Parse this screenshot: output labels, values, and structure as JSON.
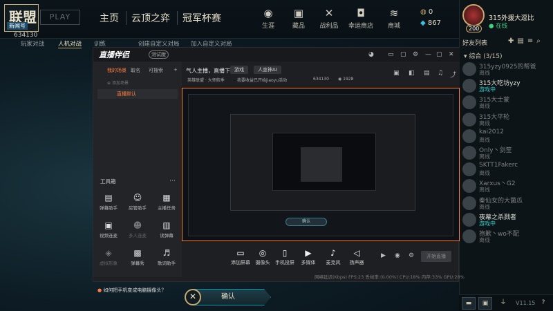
{
  "game": {
    "logo_text": "联盟",
    "logo_tag": "新闻号",
    "play_label": "PLAY",
    "user_id": "634130",
    "nav": [
      "主页",
      "云顶之弈",
      "冠军杯赛"
    ],
    "top_icons": [
      "生涯",
      "藏品",
      "战利品",
      "幸运商店",
      "商城"
    ],
    "currency_blue": "0",
    "currency_orange": "867",
    "subnav": [
      "玩家对战",
      "人机对战",
      "训练",
      "创建自定义对局",
      "加入自定义对局"
    ],
    "active_subnav": "人机对战",
    "confirm_label": "确认",
    "version": "V11.15"
  },
  "profile": {
    "name": "315外援大逗比",
    "status": "在线",
    "level": "200"
  },
  "friends": {
    "title": "好友列表",
    "group": "综合 (3/15)",
    "list": [
      {
        "name": "315yzy0925的帮爸",
        "status": "离线",
        "online": false
      },
      {
        "name": "315大吃坊yzy",
        "status": "游戏中",
        "online": true
      },
      {
        "name": "315大士蒙",
        "status": "离线",
        "online": false
      },
      {
        "name": "315大平轮",
        "status": "离线",
        "online": false
      },
      {
        "name": "kai2012",
        "status": "离线",
        "online": false
      },
      {
        "name": "Only丶剑笙",
        "status": "离线",
        "online": false
      },
      {
        "name": "SKTT1Fakerc",
        "status": "离线",
        "online": false
      },
      {
        "name": "Xarxus丶G2",
        "status": "离线",
        "online": false
      },
      {
        "name": "秦仙女的大菌瓜",
        "status": "离线",
        "online": false
      },
      {
        "name": "夜幕之杀戮者",
        "status": "游戏中",
        "online": true
      },
      {
        "name": "抱歉丶wo不配",
        "status": "离线",
        "online": false
      }
    ]
  },
  "stream_app": {
    "brand": "直播伴侣",
    "beta": "测试版",
    "left_tabs": [
      "我的场景",
      "取名",
      "可搜索"
    ],
    "scene_name": "直播默认",
    "add_scene": "添加场景",
    "tools_title": "工具箱",
    "tools": [
      {
        "label": "弹幕助手",
        "dim": false
      },
      {
        "label": "房管助手",
        "dim": false
      },
      {
        "label": "主播任务",
        "dim": false
      },
      {
        "label": "视频连麦",
        "dim": false
      },
      {
        "label": "多人连麦",
        "dim": true
      },
      {
        "label": "读弹幕",
        "dim": false
      },
      {
        "label": "虚拟形象",
        "dim": true
      },
      {
        "label": "弹幕秀",
        "dim": false
      },
      {
        "label": "歌词助手",
        "dim": false
      }
    ],
    "title_text": "气人主播，直播下分",
    "category": "游戏",
    "tag": "人宣神AI",
    "sub_info": "英雄联盟 · 大师航季",
    "sub_info2": "我要收益已开始jiaoyu活动",
    "room_id": "634130",
    "viewers": "1928",
    "controls": [
      "添加屏幕",
      "摄像头",
      "手机投屏",
      "多媒体",
      "麦克风",
      "扬声器"
    ],
    "start_label": "开始直播",
    "status_bar": "网络延迟(Kbps)   FPS:23   丢帧率:(0.00%)   CPU:18%   内存:33%   GPU:28%",
    "hint": "如何把手机变成电脑摄像头？",
    "inner_confirm": "确认"
  }
}
